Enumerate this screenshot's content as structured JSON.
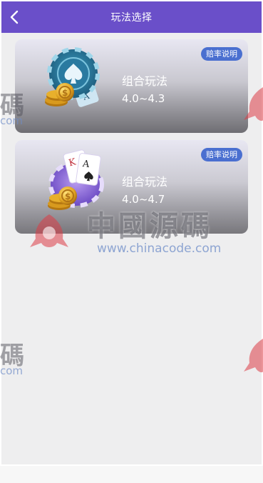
{
  "header": {
    "title": "玩法选择",
    "back_icon": "chevron-left-icon"
  },
  "games": [
    {
      "name": "组合玩法",
      "odds_range": "4.0~4.3",
      "badge": "赔率说明",
      "icon": "poker-chip-icon"
    },
    {
      "name": "组合玩法",
      "odds_range": "4.0~4.7",
      "badge": "赔率说明",
      "icon": "playing-cards-icon"
    }
  ],
  "watermark": {
    "text": "中國源碼",
    "url": "www.chinacode.com",
    "side_char": "碼",
    "side_url": "com"
  },
  "colors": {
    "header_bg": "#6a4fc9",
    "badge_bg": "#4a6fd0",
    "page_bg": "#eeeeef"
  }
}
